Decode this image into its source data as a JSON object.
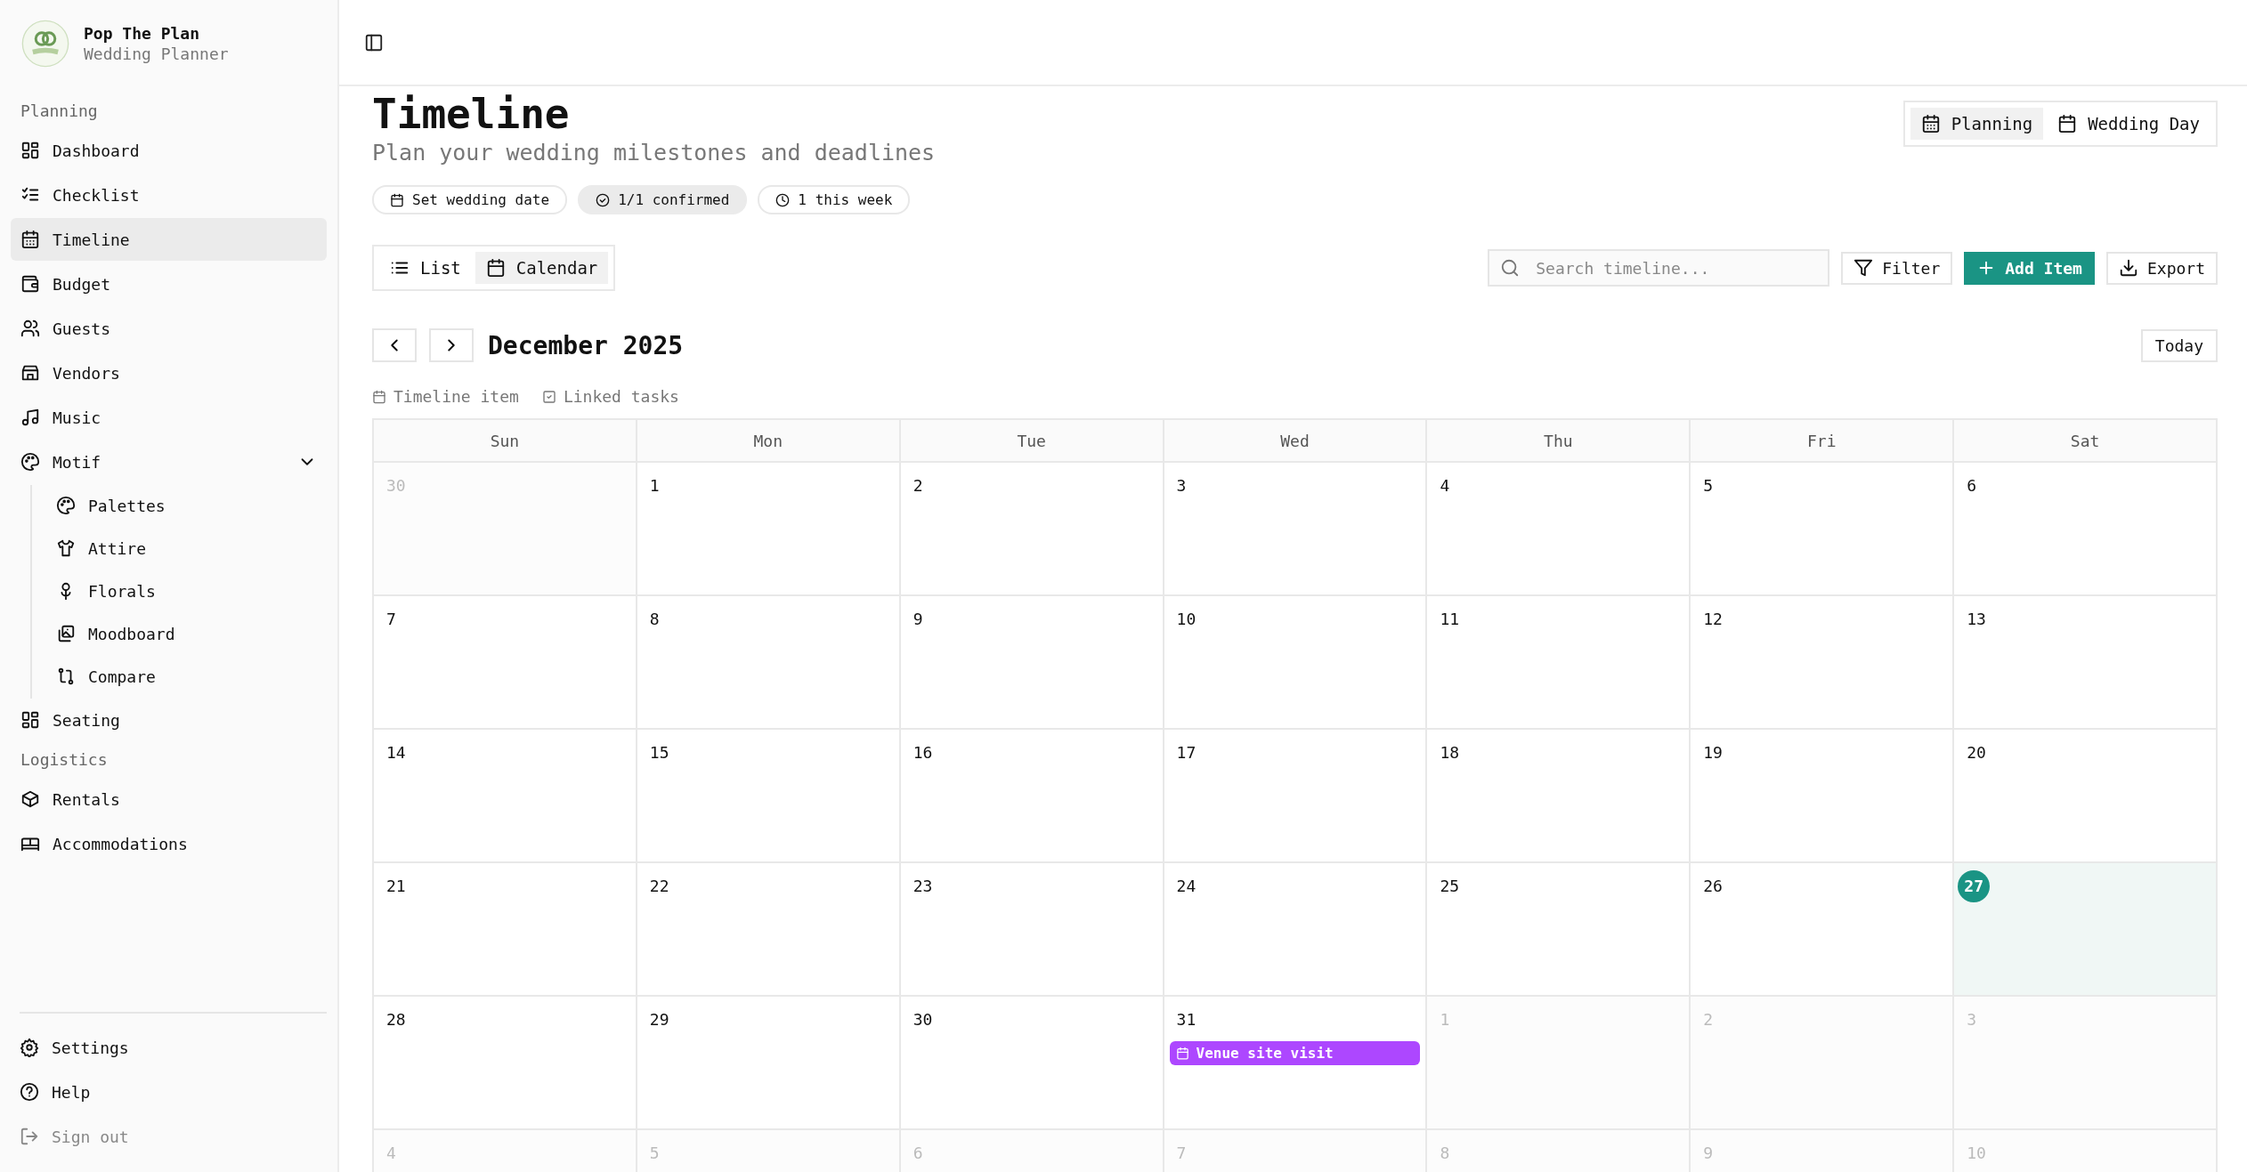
{
  "brand": {
    "name": "Pop The Plan",
    "subtitle": "Wedding Planner"
  },
  "sidebar": {
    "sections": [
      {
        "heading": "Planning",
        "items": [
          {
            "label": "Dashboard",
            "selected": false
          },
          {
            "label": "Checklist",
            "selected": false
          },
          {
            "label": "Timeline",
            "selected": true
          },
          {
            "label": "Budget",
            "selected": false
          },
          {
            "label": "Guests",
            "selected": false
          },
          {
            "label": "Vendors",
            "selected": false
          },
          {
            "label": "Music",
            "selected": false
          },
          {
            "label": "Motif",
            "selected": false,
            "expanded": true,
            "children": [
              {
                "label": "Palettes",
                "selected": false
              },
              {
                "label": "Attire",
                "selected": false
              },
              {
                "label": "Florals",
                "selected": false
              },
              {
                "label": "Moodboard",
                "selected": false
              },
              {
                "label": "Compare",
                "selected": false
              }
            ]
          },
          {
            "label": "Seating",
            "selected": false
          }
        ]
      },
      {
        "heading": "Logistics",
        "items": [
          {
            "label": "Rentals",
            "selected": false
          },
          {
            "label": "Accommodations",
            "selected": false
          }
        ]
      }
    ],
    "footer": [
      {
        "label": "Settings",
        "muted": false
      },
      {
        "label": "Help",
        "muted": false
      },
      {
        "label": "Sign out",
        "muted": true
      }
    ]
  },
  "page": {
    "title": "Timeline",
    "subtitle": "Plan your wedding milestones and deadlines",
    "mode_toggle": [
      {
        "label": "Planning",
        "selected": true
      },
      {
        "label": "Wedding Day",
        "selected": false
      }
    ],
    "stats": [
      {
        "label": "Set wedding date",
        "active": false
      },
      {
        "label": "1/1 confirmed",
        "active": true
      },
      {
        "label": "1 this week",
        "active": false
      }
    ],
    "view_toggle": [
      {
        "label": "List",
        "selected": false
      },
      {
        "label": "Calendar",
        "selected": true
      }
    ],
    "search": {
      "placeholder": "Search timeline..."
    },
    "actions": [
      {
        "label": "Filter",
        "kind": "outline"
      },
      {
        "label": "Add Item",
        "kind": "primary"
      },
      {
        "label": "Export",
        "kind": "outline"
      }
    ]
  },
  "calendar": {
    "month": "December 2025",
    "today_button": "Today",
    "legend": [
      "Timeline item",
      "Linked tasks"
    ],
    "weekdays": [
      "Sun",
      "Mon",
      "Tue",
      "Wed",
      "Thu",
      "Fri",
      "Sat"
    ],
    "weeks": [
      [
        {
          "day": "30",
          "in_month": false,
          "today": false
        },
        {
          "day": "1",
          "in_month": true,
          "today": false
        },
        {
          "day": "2",
          "in_month": true,
          "today": false
        },
        {
          "day": "3",
          "in_month": true,
          "today": false
        },
        {
          "day": "4",
          "in_month": true,
          "today": false
        },
        {
          "day": "5",
          "in_month": true,
          "today": false
        },
        {
          "day": "6",
          "in_month": true,
          "today": false
        }
      ],
      [
        {
          "day": "7",
          "in_month": true,
          "today": false
        },
        {
          "day": "8",
          "in_month": true,
          "today": false
        },
        {
          "day": "9",
          "in_month": true,
          "today": false
        },
        {
          "day": "10",
          "in_month": true,
          "today": false
        },
        {
          "day": "11",
          "in_month": true,
          "today": false
        },
        {
          "day": "12",
          "in_month": true,
          "today": false
        },
        {
          "day": "13",
          "in_month": true,
          "today": false
        }
      ],
      [
        {
          "day": "14",
          "in_month": true,
          "today": false
        },
        {
          "day": "15",
          "in_month": true,
          "today": false
        },
        {
          "day": "16",
          "in_month": true,
          "today": false
        },
        {
          "day": "17",
          "in_month": true,
          "today": false
        },
        {
          "day": "18",
          "in_month": true,
          "today": false
        },
        {
          "day": "19",
          "in_month": true,
          "today": false
        },
        {
          "day": "20",
          "in_month": true,
          "today": false
        }
      ],
      [
        {
          "day": "21",
          "in_month": true,
          "today": false
        },
        {
          "day": "22",
          "in_month": true,
          "today": false
        },
        {
          "day": "23",
          "in_month": true,
          "today": false
        },
        {
          "day": "24",
          "in_month": true,
          "today": false
        },
        {
          "day": "25",
          "in_month": true,
          "today": false
        },
        {
          "day": "26",
          "in_month": true,
          "today": false
        },
        {
          "day": "27",
          "in_month": true,
          "today": true
        }
      ],
      [
        {
          "day": "28",
          "in_month": true,
          "today": false
        },
        {
          "day": "29",
          "in_month": true,
          "today": false
        },
        {
          "day": "30",
          "in_month": true,
          "today": false
        },
        {
          "day": "31",
          "in_month": true,
          "today": false,
          "events": [
            {
              "title": "Venue site visit",
              "color": "#ad47ff"
            }
          ]
        },
        {
          "day": "1",
          "in_month": false,
          "today": false
        },
        {
          "day": "2",
          "in_month": false,
          "today": false
        },
        {
          "day": "3",
          "in_month": false,
          "today": false
        }
      ],
      [
        {
          "day": "4",
          "in_month": false,
          "today": false
        },
        {
          "day": "5",
          "in_month": false,
          "today": false
        },
        {
          "day": "6",
          "in_month": false,
          "today": false
        },
        {
          "day": "7",
          "in_month": false,
          "today": false
        },
        {
          "day": "8",
          "in_month": false,
          "today": false
        },
        {
          "day": "9",
          "in_month": false,
          "today": false
        },
        {
          "day": "10",
          "in_month": false,
          "today": false
        }
      ]
    ]
  }
}
